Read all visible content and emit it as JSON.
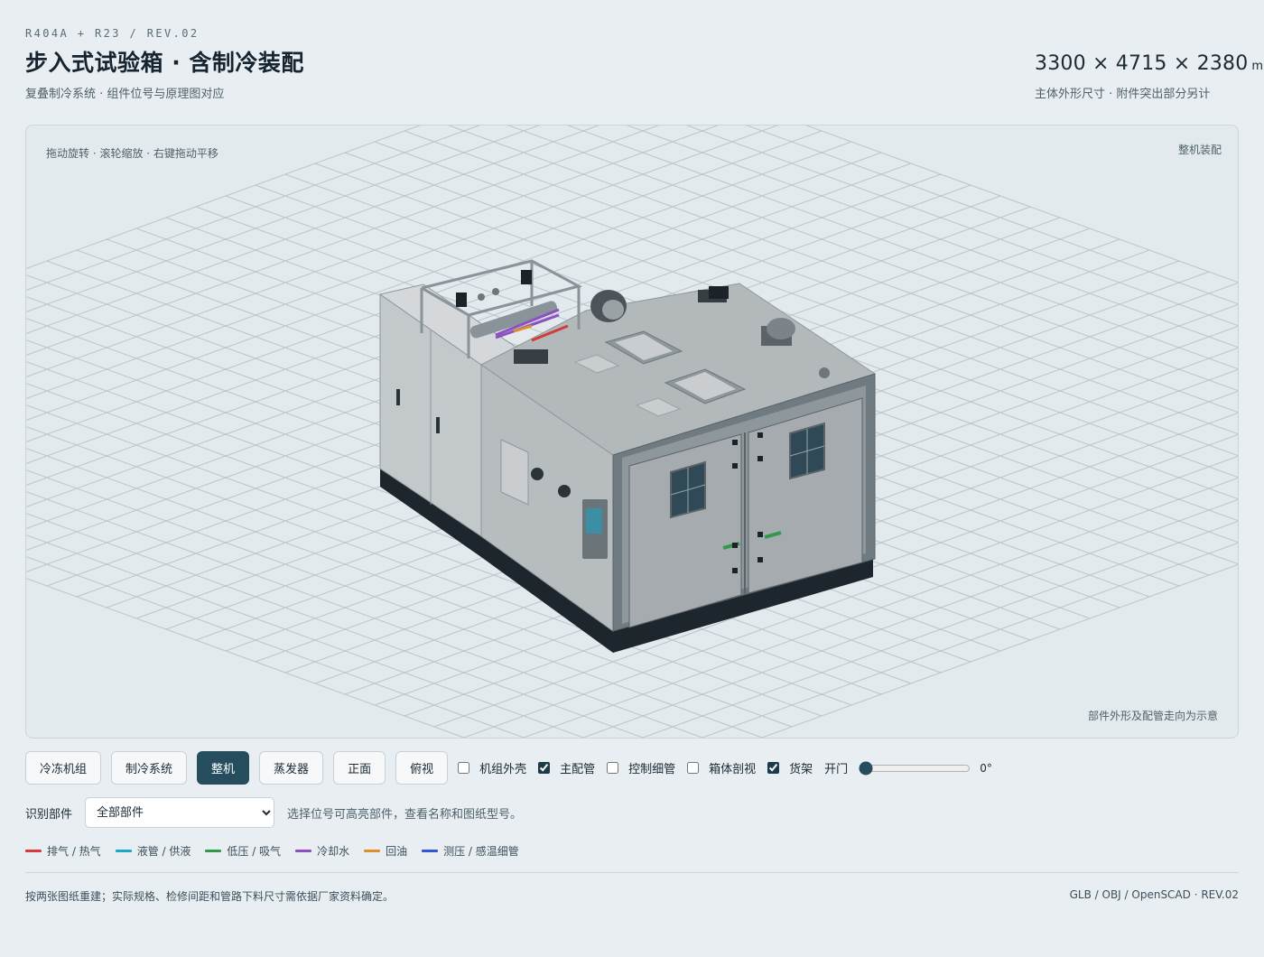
{
  "header": {
    "code": "R404A + R23 / REV.02",
    "title": "步入式试验箱 · 含制冷装配",
    "subtitle": "复叠制冷系统 · 组件位号与原理图对应",
    "dims": "3300 × 4715 × 2380",
    "dims_unit": "mm",
    "dims_note": "主体外形尺寸 · 附件突出部分另计"
  },
  "viewport": {
    "hint": "拖动旋转 · 滚轮缩放 · 右键拖动平移",
    "mode": "整机装配",
    "note": "部件外形及配管走向为示意"
  },
  "toolbar": {
    "buttons": [
      {
        "label": "冷冻机组",
        "active": false
      },
      {
        "label": "制冷系统",
        "active": false
      },
      {
        "label": "整机",
        "active": true
      },
      {
        "label": "蒸发器",
        "active": false
      },
      {
        "label": "正面",
        "active": false
      },
      {
        "label": "俯视",
        "active": false
      }
    ],
    "toggles": [
      {
        "label": "机组外壳",
        "checked": false
      },
      {
        "label": "主配管",
        "checked": true
      },
      {
        "label": "控制细管",
        "checked": false
      },
      {
        "label": "箱体剖视",
        "checked": false
      },
      {
        "label": "货架",
        "checked": true
      }
    ],
    "door_label": "开门",
    "door_angle": 0,
    "door_angle_text": "0°"
  },
  "identify": {
    "label": "识别部件",
    "selected": "全部部件",
    "hint": "选择位号可高亮部件，查看名称和图纸型号。"
  },
  "legend": [
    {
      "label": "排气 / 热气",
      "color": "#d63a3a"
    },
    {
      "label": "液管 / 供液",
      "color": "#1ba8c4"
    },
    {
      "label": "低压 / 吸气",
      "color": "#2e9a4a"
    },
    {
      "label": "冷却水",
      "color": "#8e4fc2"
    },
    {
      "label": "回油",
      "color": "#df8f2a"
    },
    {
      "label": "测压 / 感温细管",
      "color": "#3156d6"
    }
  ],
  "footer": {
    "left": "按两张图纸重建；实际规格、检修间距和管路下料尺寸需依据厂家资料确定。",
    "right": "GLB / OBJ / OpenSCAD · REV.02"
  }
}
